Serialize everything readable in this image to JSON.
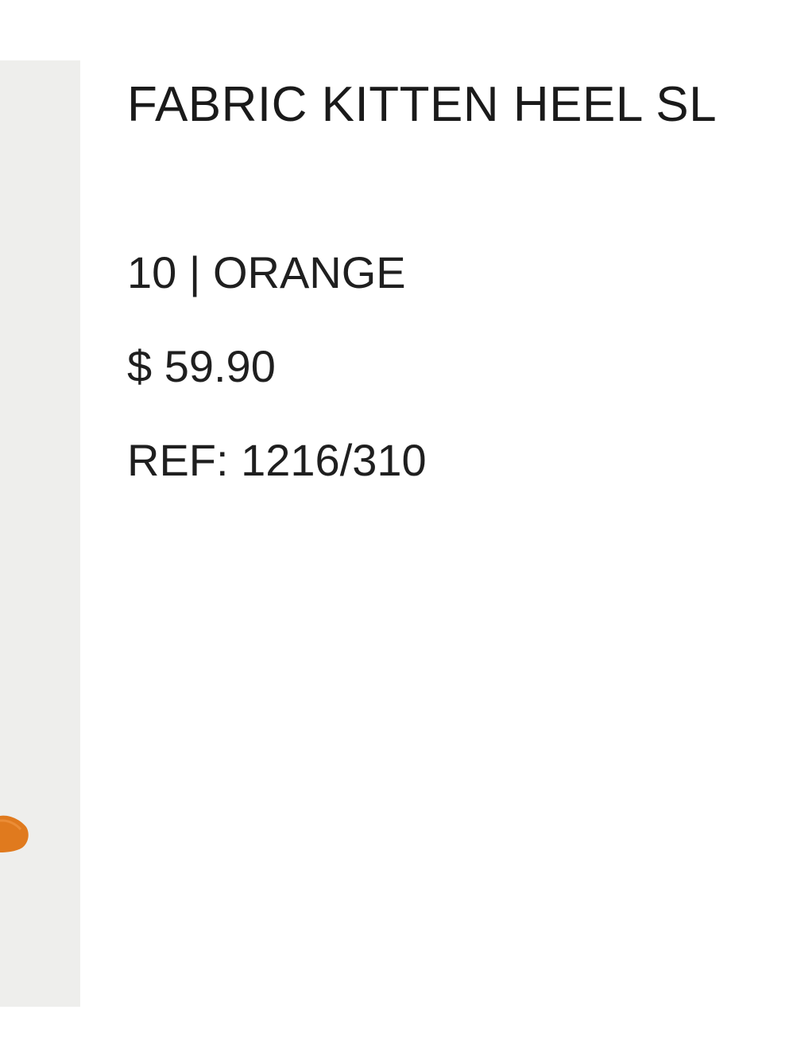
{
  "product": {
    "title": "FABRIC KITTEN HEEL SL",
    "size_color": "10 | ORANGE",
    "price": "$ 59.90",
    "ref": "REF: 1216/310"
  },
  "colors": {
    "image_bg": "#eeeeec",
    "shoe": "#e07a1e",
    "text": "#1a1a1a"
  }
}
